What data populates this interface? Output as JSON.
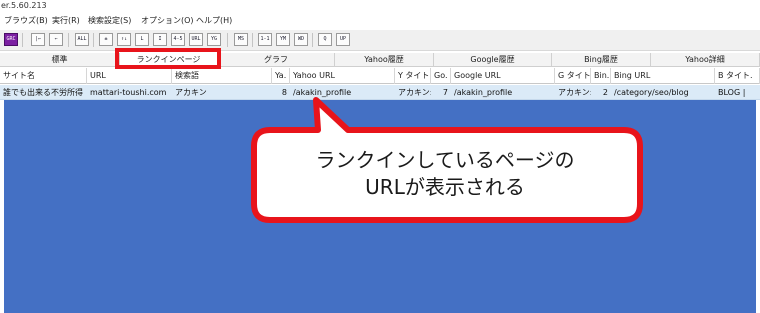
{
  "window": {
    "title": "er.5.60.213"
  },
  "menu": [
    {
      "label": "ブラウズ(B)"
    },
    {
      "label": "実行(R)"
    },
    {
      "label": "検索設定(S)"
    },
    {
      "label": "オプション(O)"
    },
    {
      "label": "ヘルプ(H)"
    }
  ],
  "toolbar": {
    "buttons": [
      {
        "icon": "grc-logo-icon",
        "text": "GRC",
        "highlight": true
      },
      {
        "icon": "first-icon",
        "text": "|←"
      },
      {
        "icon": "prev-icon",
        "text": "←"
      },
      {
        "icon": "all-icon",
        "text": "ALL"
      },
      {
        "icon": "sort-up-icon",
        "text": "±"
      },
      {
        "icon": "sort-updown-icon",
        "text": "↑↓"
      },
      {
        "icon": "sort-l-icon",
        "text": "L"
      },
      {
        "icon": "sort-i-icon",
        "text": "I"
      },
      {
        "icon": "sort-range-icon",
        "text": "4-5"
      },
      {
        "icon": "url-icon",
        "text": "URL"
      },
      {
        "icon": "yg-icon",
        "text": "YG"
      },
      {
        "icon": "ms-icon",
        "text": "MS"
      },
      {
        "icon": "range-icon",
        "text": "1-1"
      },
      {
        "icon": "ym-icon",
        "text": "YM"
      },
      {
        "icon": "wd-icon",
        "text": "WD"
      },
      {
        "icon": "search-icon",
        "text": "Q"
      },
      {
        "icon": "grc-up-icon",
        "text": "UP"
      }
    ]
  },
  "tabs": [
    {
      "label": "標準"
    },
    {
      "label": "ランクインページ"
    },
    {
      "label": "グラフ"
    },
    {
      "label": "Yahoo履歴"
    },
    {
      "label": "Google履歴"
    },
    {
      "label": "Bing履歴"
    },
    {
      "label": "Yahoo詳細"
    }
  ],
  "grid": {
    "columns": [
      {
        "label": "サイト名"
      },
      {
        "label": "URL"
      },
      {
        "label": "検索語"
      },
      {
        "label": "Ya."
      },
      {
        "label": "Yahoo URL"
      },
      {
        "label": "Y タイト."
      },
      {
        "label": "Go."
      },
      {
        "label": "Google URL"
      },
      {
        "label": "G タイト."
      },
      {
        "label": "Bin."
      },
      {
        "label": "Bing URL"
      },
      {
        "label": "B タイト."
      }
    ],
    "rows": [
      {
        "cells": [
          "誰でも出来る不労所得",
          "mattari-toushi.com",
          "アカキン",
          "8",
          "/akakin_profile",
          "アカキン:",
          "7",
          "/akakin_profile",
          "アカキン:",
          "2",
          "/category/seo/blog",
          "BLOG |"
        ]
      }
    ]
  },
  "callout": {
    "line1": "ランクインしているページの",
    "line2": "URLが表示される",
    "border_color": "#e8141b",
    "fill_color": "#ffffff"
  },
  "colors": {
    "highlight": "#e8141b",
    "empty_area": "#4470c4",
    "selected_row": "#dbeaf7"
  }
}
